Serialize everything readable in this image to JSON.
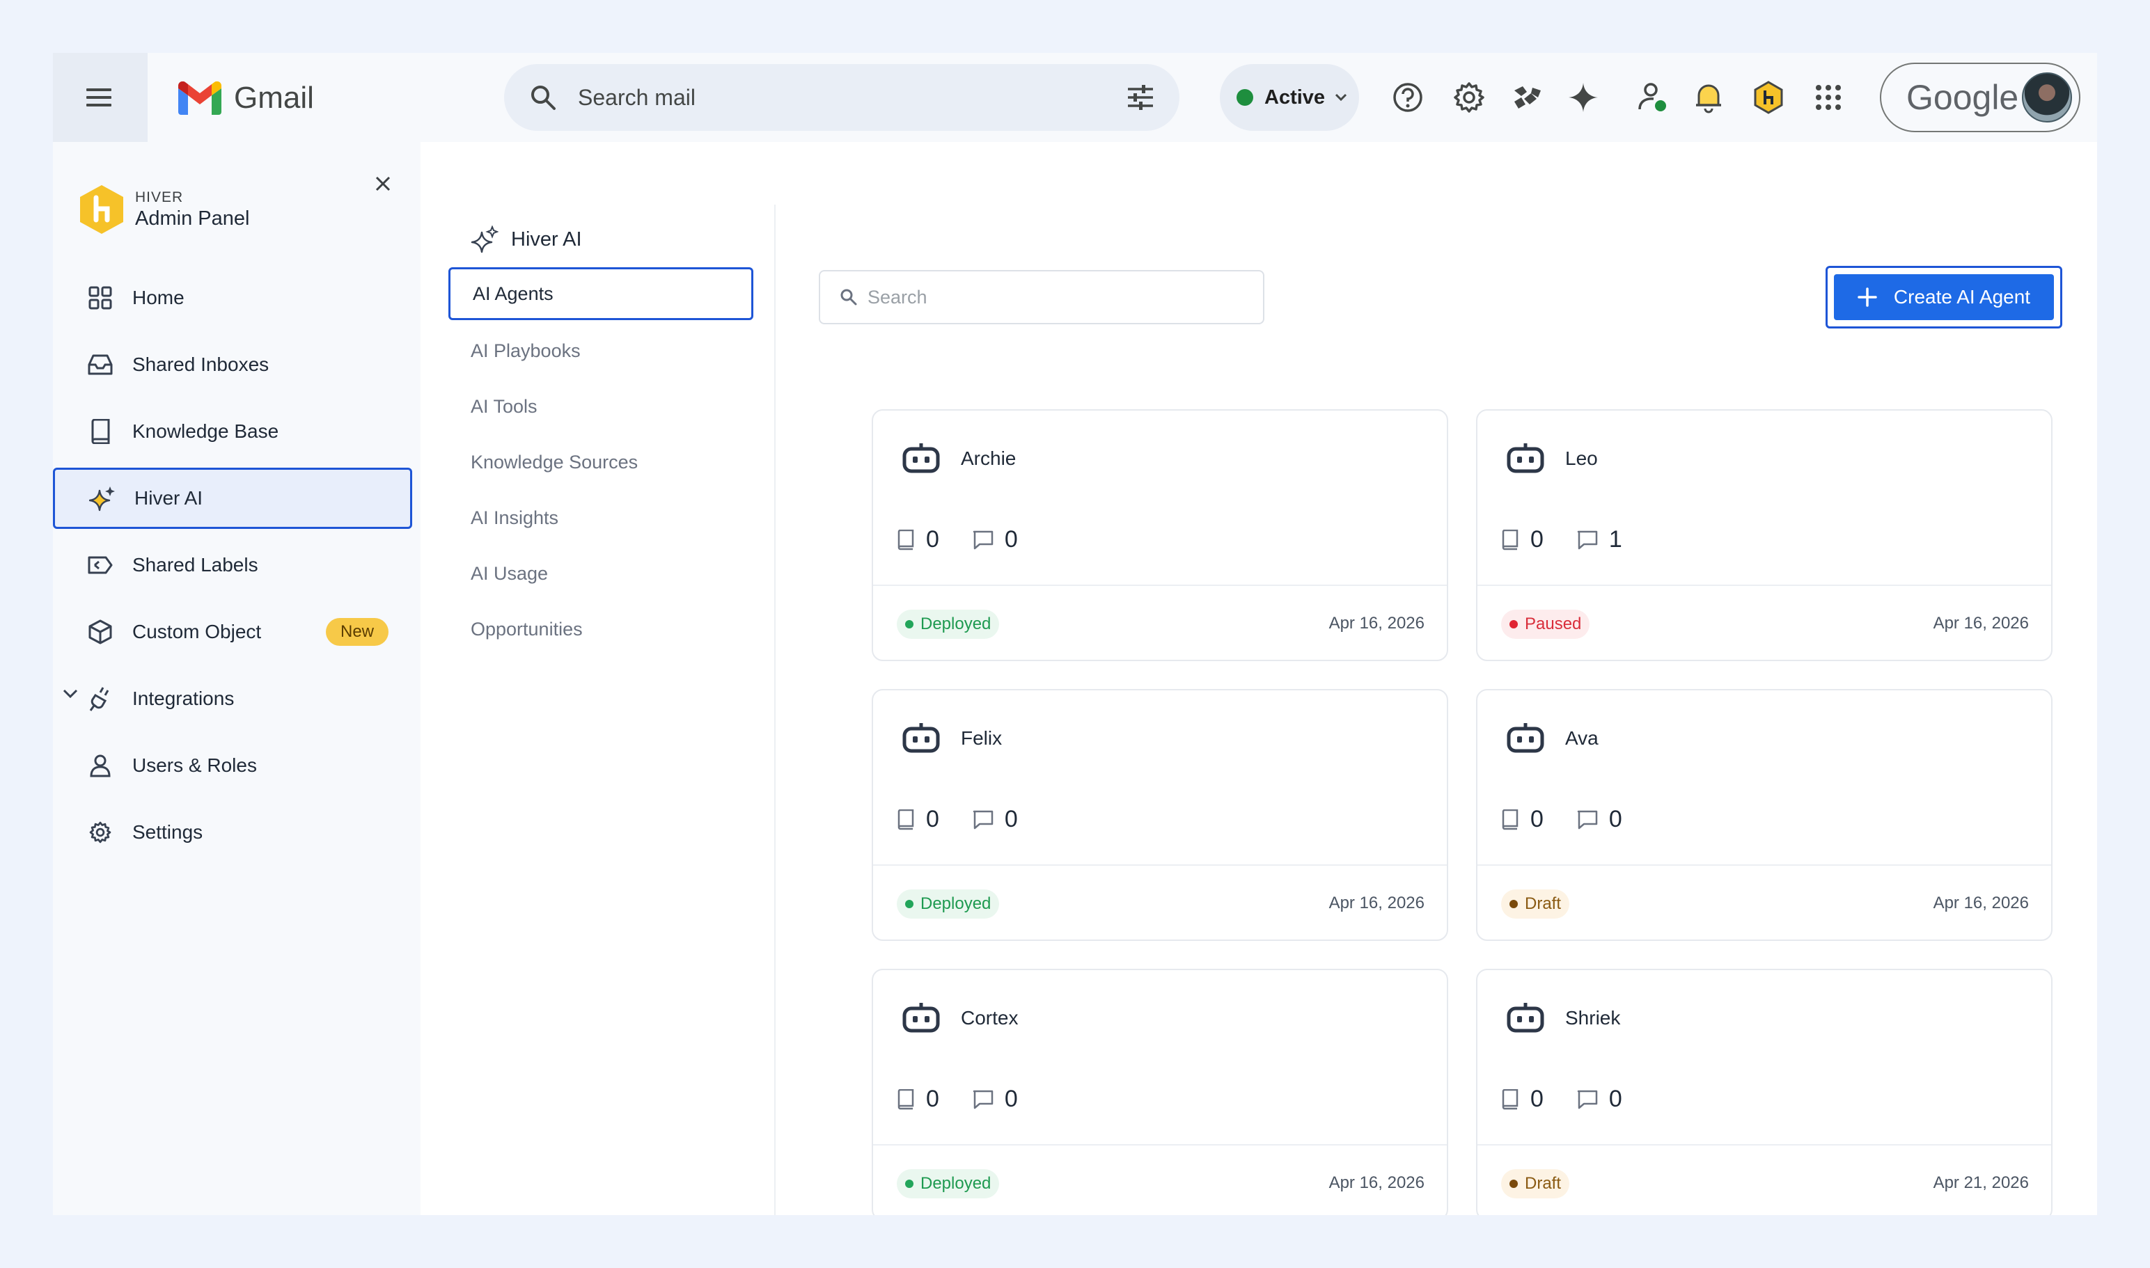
{
  "topbar": {
    "app_title": "Gmail",
    "search_placeholder": "Search mail",
    "status_label": "Active",
    "account_label": "Google"
  },
  "sidebar": {
    "brand_small": "HIVER",
    "brand_big": "Admin Panel",
    "items": [
      {
        "label": "Home",
        "icon": "grid-icon"
      },
      {
        "label": "Shared Inboxes",
        "icon": "inbox-icon"
      },
      {
        "label": "Knowledge Base",
        "icon": "book-icon"
      },
      {
        "label": "Hiver AI",
        "icon": "sparkle-icon"
      },
      {
        "label": "Shared Labels",
        "icon": "label-icon"
      },
      {
        "label": "Custom Object",
        "icon": "cube-icon",
        "badge": "New"
      },
      {
        "label": "Integrations",
        "icon": "plug-icon"
      },
      {
        "label": "Users & Roles",
        "icon": "user-icon"
      },
      {
        "label": "Settings",
        "icon": "gear-icon"
      }
    ]
  },
  "subnav": {
    "heading": "Hiver AI",
    "items": [
      "AI Agents",
      "AI Playbooks",
      "AI Tools",
      "Knowledge Sources",
      "AI Insights",
      "AI Usage",
      "Opportunities"
    ]
  },
  "main": {
    "search_placeholder": "Search",
    "create_label": "Create AI Agent",
    "agents": [
      {
        "name": "Archie",
        "kb_count": "0",
        "chat_count": "0",
        "status": "Deployed",
        "date": "Apr 16, 2026"
      },
      {
        "name": "Leo",
        "kb_count": "0",
        "chat_count": "1",
        "status": "Paused",
        "date": "Apr 16, 2026"
      },
      {
        "name": "Felix",
        "kb_count": "0",
        "chat_count": "0",
        "status": "Deployed",
        "date": "Apr 16, 2026"
      },
      {
        "name": "Ava",
        "kb_count": "0",
        "chat_count": "0",
        "status": "Draft",
        "date": "Apr 16, 2026"
      },
      {
        "name": "Cortex",
        "kb_count": "0",
        "chat_count": "0",
        "status": "Deployed",
        "date": "Apr 16, 2026"
      },
      {
        "name": "Shriek",
        "kb_count": "0",
        "chat_count": "0",
        "status": "Draft",
        "date": "Apr 21, 2026"
      }
    ]
  },
  "colors": {
    "accent": "#1e55d6",
    "button": "#1e6ae6",
    "deployed": "#22a55a",
    "paused": "#e02433",
    "draft": "#7a4a0c",
    "badge_new": "#f7c948"
  }
}
